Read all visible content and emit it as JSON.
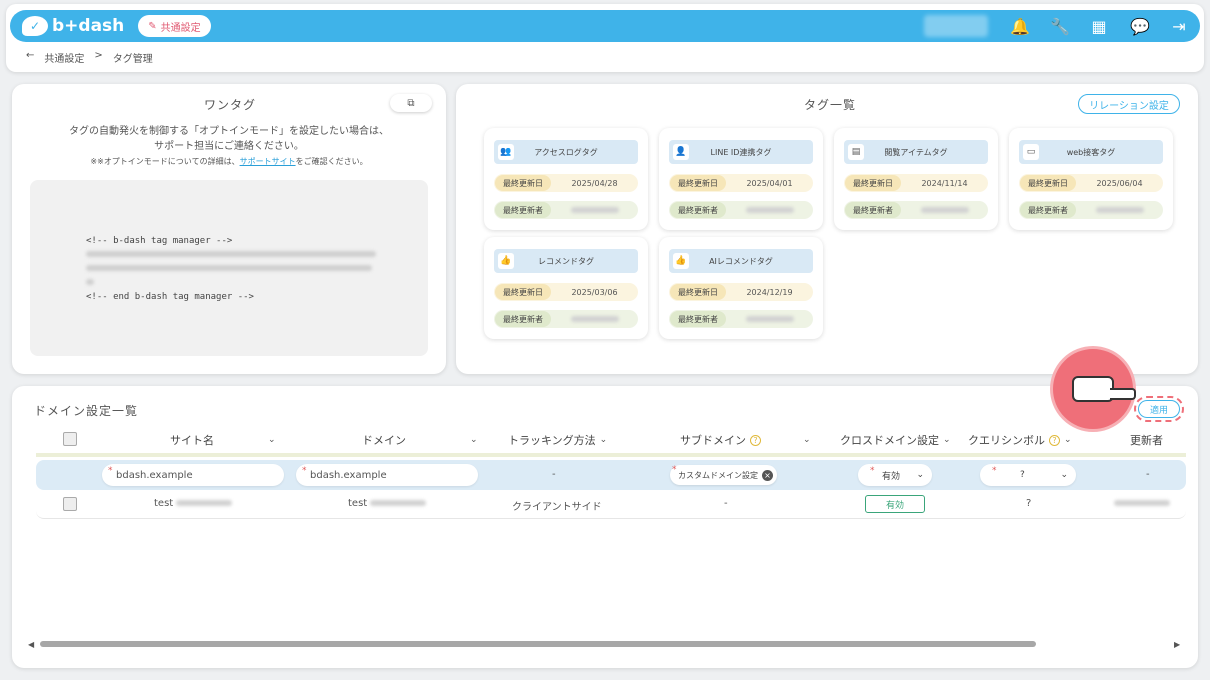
{
  "header": {
    "logo_text": "b+dash",
    "settings_pill": "共通設定",
    "icons": [
      "bell-icon",
      "wrench-icon",
      "grid-icon",
      "chat-icon",
      "logout-icon"
    ]
  },
  "breadcrumb": {
    "back": "←",
    "parent": "共通設定",
    "sep": ">",
    "current": "タグ管理"
  },
  "one_tag": {
    "title": "ワンタグ",
    "desc1": "タグの自動発火を制御する「オプトインモード」を設定したい場合は、",
    "desc2": "サポート担当にご連絡ください。",
    "note_pre": "※※オプトインモードについての詳細は、",
    "note_link": "サポートサイト",
    "note_post": "をご確認ください。",
    "code_start": "<!-- b-dash tag manager -->",
    "code_end": "<!-- end b-dash tag manager -->"
  },
  "tag_list": {
    "title": "タグ一覧",
    "relation_button": "リレーション設定",
    "date_label": "最終更新日",
    "updater_label": "最終更新者",
    "tags": [
      {
        "name": "アクセスログタグ",
        "icon": "users-icon",
        "date": "2025/04/28"
      },
      {
        "name": "LINE ID連携タグ",
        "icon": "user-icon",
        "date": "2025/04/01"
      },
      {
        "name": "閲覧アイテムタグ",
        "icon": "list-icon",
        "date": "2024/11/14"
      },
      {
        "name": "web接客タグ",
        "icon": "monitor-icon",
        "date": "2025/06/04"
      },
      {
        "name": "レコメンドタグ",
        "icon": "thumbs-up-icon",
        "date": "2025/03/06"
      },
      {
        "name": "AIレコメンドタグ",
        "icon": "thumbs-up-icon",
        "date": "2024/12/19"
      }
    ]
  },
  "domain": {
    "title": "ドメイン設定一覧",
    "apply_button": "適用",
    "columns": {
      "site": "サイト名",
      "domain": "ドメイン",
      "tracking": "トラッキング方法",
      "subdomain": "サブドメイン",
      "cross": "クロスドメイン設定",
      "query": "クエリシンボル",
      "updater": "更新者"
    },
    "edit_row": {
      "site_value": "bdash.example",
      "domain_value": "bdash.example",
      "tracking": "-",
      "subdomain_chip": "カスタムドメイン設定",
      "cross_value": "有効",
      "query_value": "?",
      "updater": "-"
    },
    "data_row": {
      "site": "test",
      "domain": "test",
      "tracking": "クライアントサイド",
      "subdomain": "-",
      "cross": "有効",
      "query": "?"
    }
  }
}
